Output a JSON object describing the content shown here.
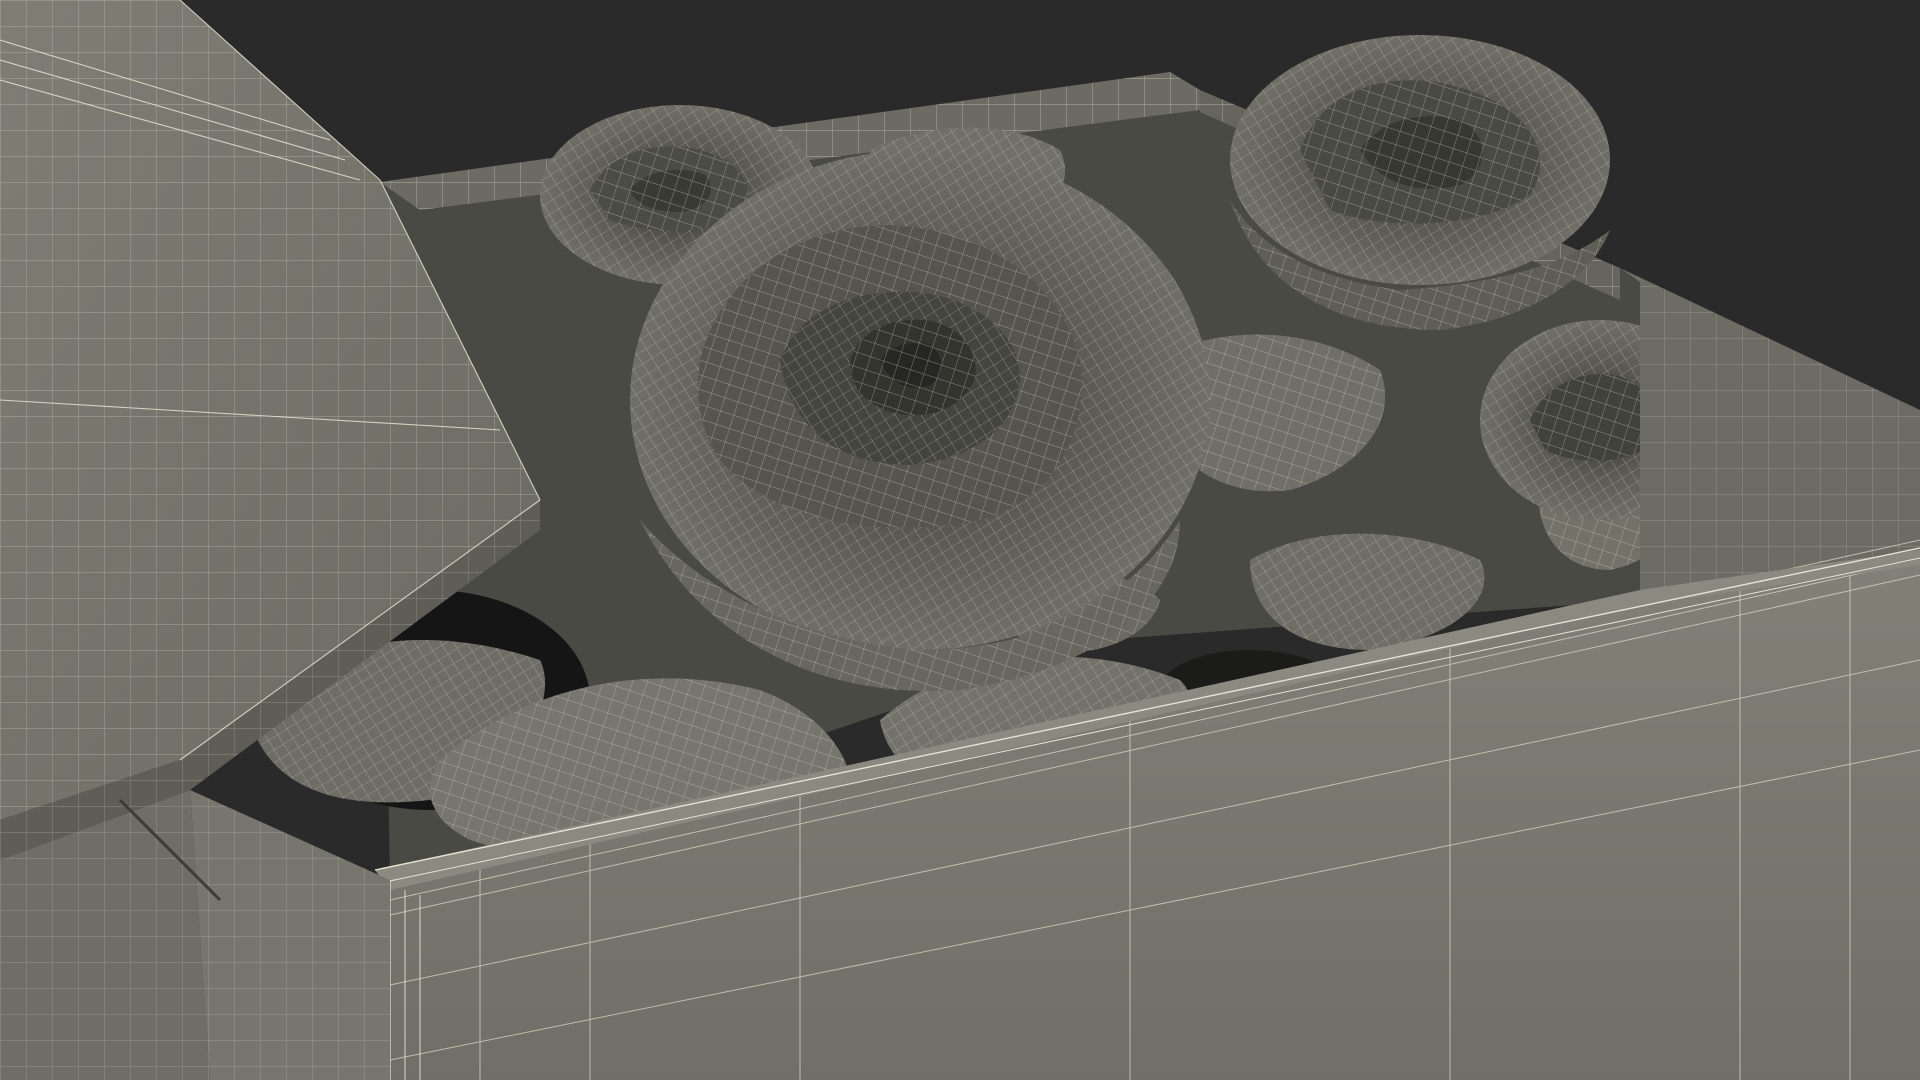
{
  "scene": {
    "subject": "wireframe-render-gift-box-with-roses",
    "colors": {
      "background": "#2a2a2a",
      "box_surface": "#7c7c73",
      "box_shadow": "#5e5e56",
      "box_interior": "#4a4a44",
      "wire": "#d9d6c4",
      "rose_light": "#6d6d66",
      "rose_dark": "#3d3d38",
      "petal": "#74746c",
      "deep_shadow": "#151515"
    }
  }
}
